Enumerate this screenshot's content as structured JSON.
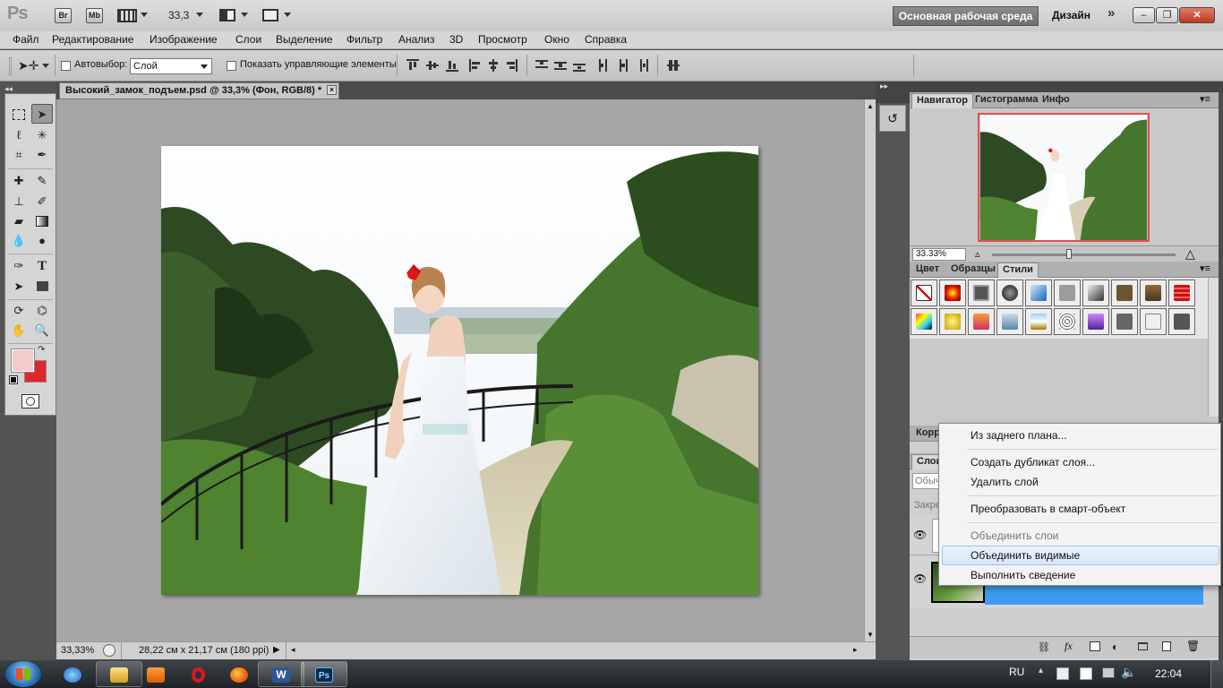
{
  "app": {
    "logo": "Ps",
    "bridge_label": "Br",
    "minibridge_label": "Mb",
    "zoom_level": "33,3",
    "workspace_button": "Основная рабочая среда",
    "design_label": "Дизайн",
    "more_workspaces": "»"
  },
  "menu": [
    "Файл",
    "Редактирование",
    "Изображение",
    "Слои",
    "Выделение",
    "Фильтр",
    "Анализ",
    "3D",
    "Просмотр",
    "Окно",
    "Справка"
  ],
  "options": {
    "autoselect_label": "Автовыбор:",
    "autoselect_value": "Слой",
    "show_controls_label": "Показать управляющие элементы"
  },
  "document": {
    "tab_title": "Высокий_замок_подъем.psd @ 33,3% (Фон, RGB/8) *",
    "close_icon": "×"
  },
  "status": {
    "zoom": "33,33%",
    "doc_info": "28,22 см x 21,17 см (180 ppi)"
  },
  "navigator": {
    "tabs": [
      "Навигатор",
      "Гистограмма",
      "Инфо"
    ],
    "zoom": "33.33%"
  },
  "styles_panel": {
    "tabs": [
      "Цвет",
      "Образцы",
      "Стили"
    ]
  },
  "layers_panel": {
    "tab_partial_1": "Корр",
    "tab_partial_2": "Слои",
    "blend_partial": "Обыч",
    "lock_partial": "Закре"
  },
  "context_menu": {
    "items": [
      {
        "label": "Из заднего плана...",
        "enabled": true
      },
      {
        "label": "Создать дубликат слоя...",
        "enabled": true
      },
      {
        "label": "Удалить слой",
        "enabled": true
      },
      {
        "label": "Преобразовать в смарт-объект",
        "enabled": true
      },
      {
        "label": "Объединить слои",
        "enabled": false
      },
      {
        "label": "Объединить видимые",
        "enabled": true,
        "highlighted": true
      },
      {
        "label": "Выполнить сведение",
        "enabled": true
      }
    ]
  },
  "taskbar": {
    "language": "RU",
    "clock": "22:04",
    "apps": [
      "ie-icon",
      "explorer-icon",
      "media-player-icon",
      "opera-icon",
      "firefox-icon",
      "word-icon",
      "photoshop-icon"
    ]
  },
  "colors": {
    "foreground": "#f5caca",
    "background": "#e0262c",
    "layer_selected": "#3c9df0",
    "menu_highlight": "#d7e7f8"
  }
}
